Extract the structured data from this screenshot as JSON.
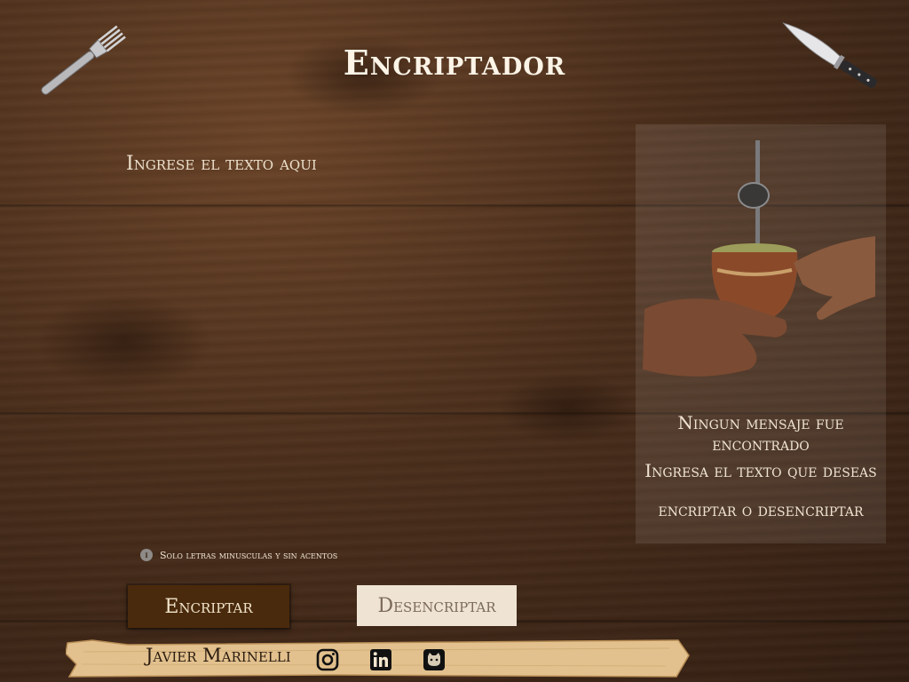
{
  "app": {
    "title": "Encriptador"
  },
  "input": {
    "placeholder": "Ingrese el texto aqui",
    "value": ""
  },
  "output": {
    "title": "Ningun mensaje fue encontrado",
    "subtitle": "Ingresa el texto que deseas encriptar o desencriptar",
    "image": "mate-gourd-illustration"
  },
  "hint": {
    "icon": "info-icon",
    "text": "Solo letras minusculas y sin acentos"
  },
  "buttons": {
    "encrypt_label": "Encriptar",
    "decrypt_label": "Desencriptar"
  },
  "footer": {
    "author": "Javier Marinelli",
    "social": [
      {
        "icon": "instagram-icon"
      },
      {
        "icon": "linkedin-icon"
      },
      {
        "icon": "github-icon"
      }
    ]
  },
  "decor": {
    "left_icon": "fork-icon",
    "right_icon": "knife-icon"
  },
  "colors": {
    "encrypt_button_bg": "#4a2a0c",
    "decrypt_button_bg": "#efe3d3",
    "text_light": "#f1e6d4"
  }
}
